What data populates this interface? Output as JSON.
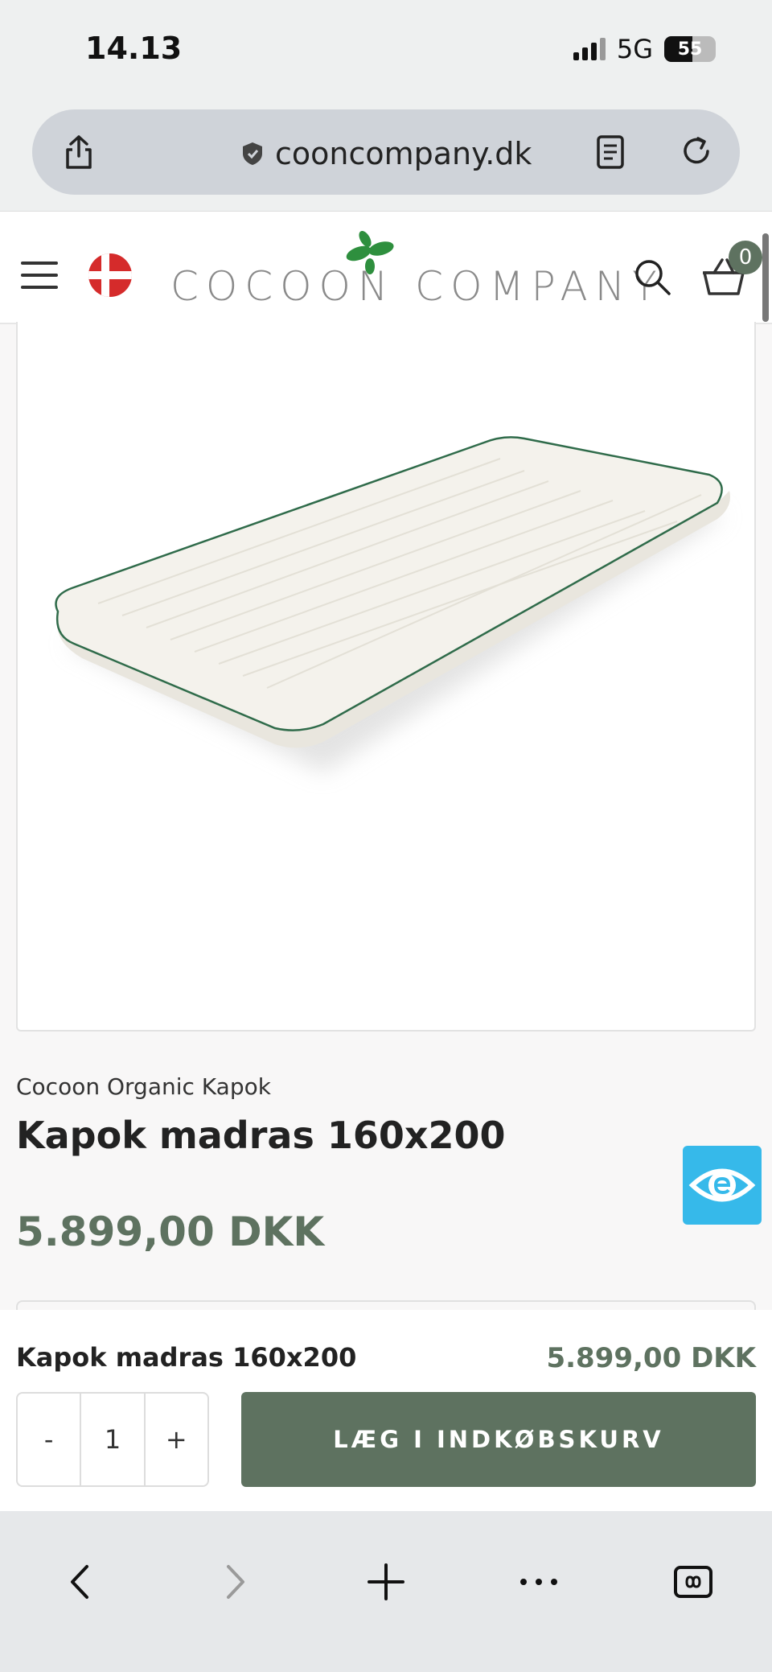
{
  "status_bar": {
    "time": "14.13",
    "network": "5G",
    "battery": "55"
  },
  "browser": {
    "url": "cooncompany.dk"
  },
  "header": {
    "logo_text": "COCOON COMPANY",
    "cart_count": "0"
  },
  "product": {
    "brand": "Cocoon Organic Kapok",
    "title": "Kapok madras 160x200",
    "price": "5.899,00 DKK"
  },
  "sticky_cart": {
    "title": "Kapok madras 160x200",
    "price": "5.899,00 DKK",
    "qty_minus": "-",
    "qty_value": "1",
    "qty_plus": "+",
    "add_label": "LÆG I INDKØBSKURV"
  },
  "colors": {
    "accent": "#5e7260",
    "badge": "#36b9ea",
    "flag": "#d52b2b"
  },
  "icons": [
    "share-icon",
    "shield-icon",
    "reader-icon",
    "reload-icon",
    "menu-icon",
    "search-icon",
    "basket-icon",
    "back-icon",
    "forward-icon",
    "plus-icon",
    "more-icon",
    "tabs-icon"
  ]
}
